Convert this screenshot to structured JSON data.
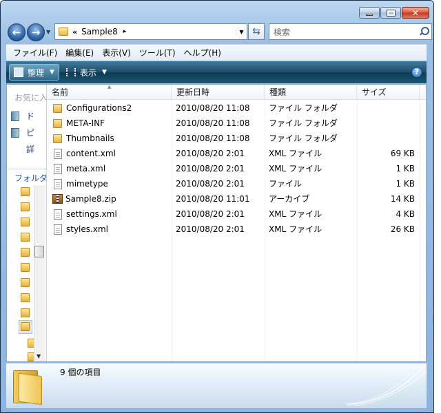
{
  "window": {
    "caption_buttons": [
      "minimize",
      "maximize",
      "close"
    ]
  },
  "address": {
    "crumb_prefix": "«",
    "location": "Sample8",
    "arrow": "▸"
  },
  "search": {
    "placeholder": "検索"
  },
  "menu": [
    "ファイル(F)",
    "編集(E)",
    "表示(V)",
    "ツール(T)",
    "ヘルプ(H)"
  ],
  "commandbar": {
    "organize": "整理",
    "views": "表示",
    "help": "?"
  },
  "navpane": {
    "favorites_label": "お気に入",
    "favorites": [
      "ド",
      "ピ",
      "詳"
    ],
    "folders_label": "フォルダ"
  },
  "columns": {
    "name": "名前",
    "date": "更新日時",
    "type": "種類",
    "size": "サイズ"
  },
  "files": [
    {
      "name": "Configurations2",
      "date": "2010/08/20 11:08",
      "type": "ファイル フォルダ",
      "size": "",
      "icon": "folder-icon"
    },
    {
      "name": "META-INF",
      "date": "2010/08/20 11:08",
      "type": "ファイル フォルダ",
      "size": "",
      "icon": "folder-icon"
    },
    {
      "name": "Thumbnails",
      "date": "2010/08/20 11:08",
      "type": "ファイル フォルダ",
      "size": "",
      "icon": "folder-icon"
    },
    {
      "name": "content.xml",
      "date": "2010/08/20 2:01",
      "type": "XML ファイル",
      "size": "69 KB",
      "icon": "file-icon"
    },
    {
      "name": "meta.xml",
      "date": "2010/08/20 2:01",
      "type": "XML ファイル",
      "size": "1 KB",
      "icon": "file-icon"
    },
    {
      "name": "mimetype",
      "date": "2010/08/20 2:01",
      "type": "ファイル",
      "size": "1 KB",
      "icon": "file-icon"
    },
    {
      "name": "Sample8.zip",
      "date": "2010/08/20 11:01",
      "type": "アーカイブ",
      "size": "14 KB",
      "icon": "zip-icon"
    },
    {
      "name": "settings.xml",
      "date": "2010/08/20 2:01",
      "type": "XML ファイル",
      "size": "4 KB",
      "icon": "file-icon"
    },
    {
      "name": "styles.xml",
      "date": "2010/08/20 2:01",
      "type": "XML ファイル",
      "size": "26 KB",
      "icon": "file-icon"
    }
  ],
  "details": {
    "item_count": "9 個の項目"
  }
}
